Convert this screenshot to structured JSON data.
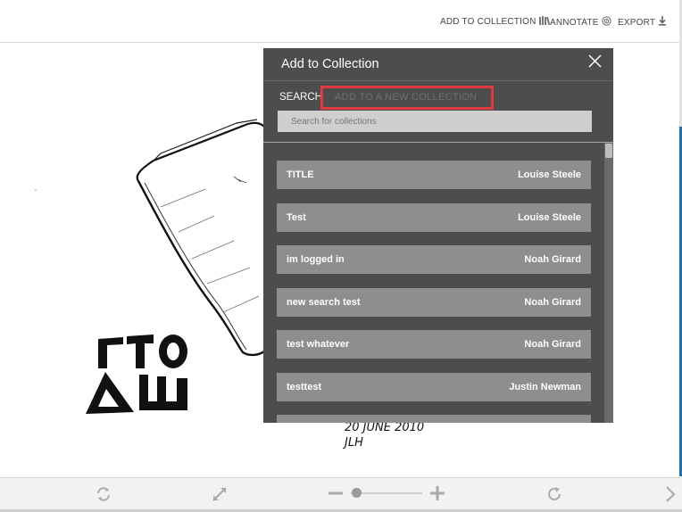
{
  "toolbar": {
    "add_to_collection": "ADD TO COLLECTION",
    "annotate": "ANNOTATE",
    "export": "EXPORT",
    "add_to_collection_icon": "books-icon",
    "annotate_icon": "target-icon",
    "export_icon": "download-icon"
  },
  "artwork": {
    "glyphs_top": "ΓΤΟ",
    "glyphs_bottom": "ΔШ",
    "date_line": "20 JUNE 2010",
    "initials": "JLH"
  },
  "modal": {
    "title": "Add to Collection",
    "tabs": {
      "search": "SEARCH",
      "new_collection": "ADD TO A NEW COLLECTION"
    },
    "search": {
      "placeholder": "Search for collections",
      "value": ""
    },
    "collections": [
      {
        "name": "TITLE",
        "owner": "Louise Steele"
      },
      {
        "name": "Test",
        "owner": "Louise Steele"
      },
      {
        "name": "im logged in",
        "owner": "Noah Girard"
      },
      {
        "name": "new search test",
        "owner": "Noah Girard"
      },
      {
        "name": "test whatever",
        "owner": "Noah Girard"
      },
      {
        "name": "testtest",
        "owner": "Justin Newman"
      },
      {
        "name": "",
        "owner": ""
      }
    ],
    "highlight_color": "#e0393e"
  },
  "viewer_controls": {
    "icons": [
      "rotate-icon",
      "fullscreen-icon",
      "zoom-out-icon",
      "zoom-in-icon",
      "reset-icon",
      "next-icon"
    ],
    "zoom_level": 0.08
  }
}
